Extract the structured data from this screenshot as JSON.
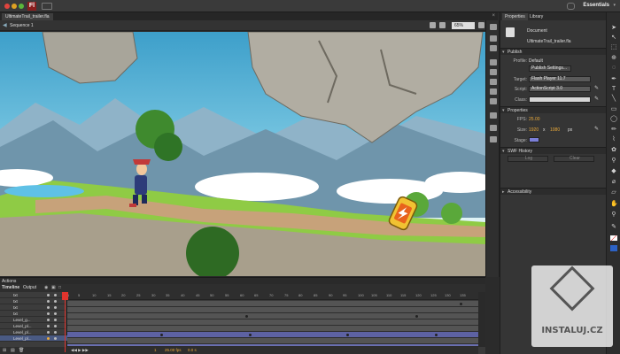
{
  "app": {
    "workspace": "Essentials",
    "logo_letter": "Fl"
  },
  "document": {
    "tab_label": "UltimateTrail_trailer.fla",
    "scene_label": "Sequence 1",
    "zoom": "65%"
  },
  "properties_panel": {
    "tabs": [
      "Properties",
      "Library"
    ],
    "doc_type": "Document",
    "doc_name": "UltimateTrail_trailer.fla",
    "publish": {
      "header": "Publish",
      "profile_label": "Profile:",
      "profile_value": "Default",
      "publish_settings_button": "Publish Settings...",
      "target_label": "Target:",
      "target_value": "Flash Player 11.7",
      "script_label": "Script:",
      "script_value": "ActionScript 3.0",
      "class_label": "Class:",
      "class_value": ""
    },
    "properties": {
      "header": "Properties",
      "fps_label": "FPS:",
      "fps_value": "25.00",
      "size_label": "Size:",
      "width": "1920",
      "x_label": "x",
      "height": "1080",
      "unit": "px",
      "stage_label": "Stage:",
      "stage_color": "#7b7fd8"
    },
    "swf_history": {
      "header": "SWF History",
      "log_button": "Log",
      "clear_button": "Clear"
    },
    "accessibility": {
      "header": "Accessibility"
    }
  },
  "timeline": {
    "tabs": [
      "Actions",
      "Timeline",
      "Output"
    ],
    "ruler_ticks": [
      "1",
      "5",
      "10",
      "15",
      "20",
      "25",
      "30",
      "35",
      "40",
      "45",
      "50",
      "55",
      "60",
      "65",
      "70",
      "75",
      "80",
      "85",
      "90",
      "95",
      "100",
      "105",
      "110",
      "115",
      "120",
      "125",
      "130",
      "135"
    ],
    "layers": [
      "txt",
      "txt",
      "txt",
      "txt",
      "Level_g...",
      "Level_pl...",
      "Level_pl...",
      "Level_pl..."
    ],
    "active_layer_index": 7,
    "current_frame": "1",
    "fps_readout": "25.00 fps",
    "elapsed": "0.0 s"
  },
  "watermark": {
    "text": "INSTALUJ.CZ"
  },
  "colors": {
    "sky_top": "#3d9fca",
    "grass": "#7cbf3c",
    "accent_orange": "#e9a93a",
    "playhead": "#e0342d",
    "active_layer": "#4a5a83"
  }
}
